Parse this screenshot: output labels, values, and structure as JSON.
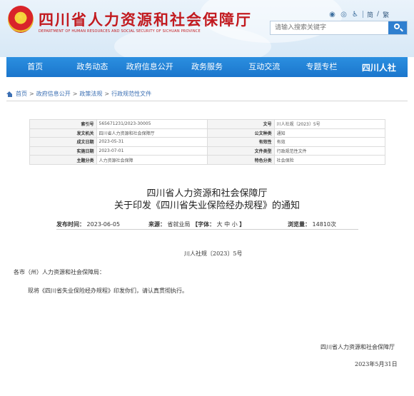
{
  "header": {
    "title": "四川省人力资源和社会保障厅",
    "subtitle": "DEPARTMENT OF HUMAN RESOURCES AND SOCIAL SECURITY OF SICHUAN PROVINCE",
    "tools": {
      "icons": [
        "wechat-icon",
        "weibo-icon",
        "accessibility-icon"
      ],
      "traditional_label": "简",
      "slash": "/",
      "english_label": "繁"
    },
    "search": {
      "placeholder": "请输入搜索关键字"
    }
  },
  "nav": {
    "items": [
      "首页",
      "政务动态",
      "政府信息公开",
      "政务服务",
      "互动交流",
      "专题专栏"
    ],
    "logo_text": "四川人社"
  },
  "breadcrumb": {
    "items": [
      "首页",
      "政府信息公开",
      "政策法规",
      "行政规范性文件"
    ],
    "separator": ">"
  },
  "meta": {
    "rows": [
      {
        "k1": "索引号",
        "v1": "565671231/2023-30005",
        "k2": "文号",
        "v2": "川人社规〔2023〕5号"
      },
      {
        "k1": "发文机关",
        "v1": "四川省人力资源和社会保障厅",
        "k2": "公文种类",
        "v2": "通知"
      },
      {
        "k1": "成文日期",
        "v1": "2023-05-31",
        "k2": "有效性",
        "v2": "有效"
      },
      {
        "k1": "实施日期",
        "v1": "2023-07-01",
        "k2": "文件类型",
        "v2": "行政规范性文件"
      },
      {
        "k1": "主题分类",
        "v1": "人力资源社会保障",
        "k2": "特色分类",
        "v2": "社会保险"
      }
    ]
  },
  "doc": {
    "title_line1": "四川省人力资源和社会保障厅",
    "title_line2": "关于印发《四川省失业保险经办规程》的通知",
    "publish_label": "发布时间：",
    "publish_date": "2023-06-05",
    "source_label": "来源：",
    "source_value": "省就业局",
    "font_label": "【字体：",
    "font_sizes": "大 中 小",
    "font_close": "】",
    "views_label": "浏览量：",
    "views_value": "14810次",
    "doc_number": "川人社规〔2023〕5号",
    "salutation": "各市（州）人力资源和社会保障局：",
    "paragraph": "现将《四川省失业保险经办规程》印发你们，请认真贯彻执行。",
    "signature": "四川省人力资源和社会保障厅",
    "date": "2023年5月31日"
  }
}
